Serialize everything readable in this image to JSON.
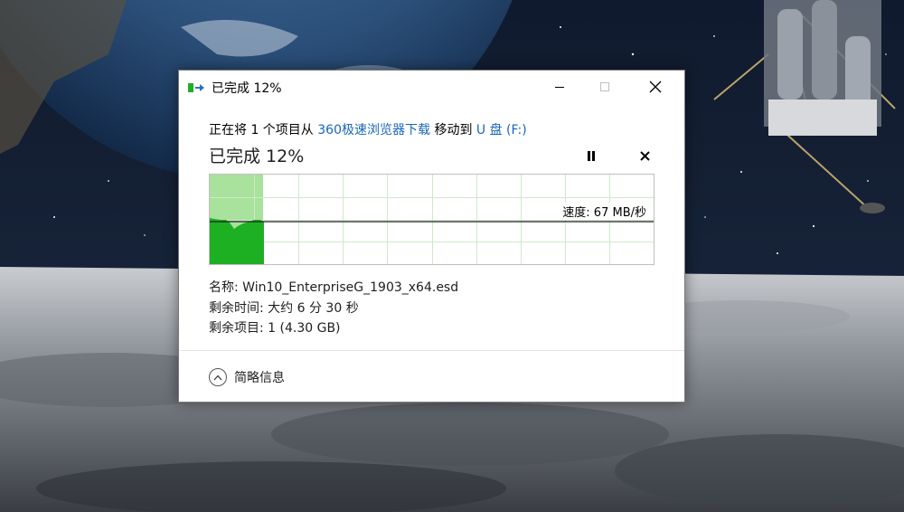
{
  "window": {
    "title": "已完成 12%",
    "minimize_icon": "minimize-icon",
    "maximize_icon": "maximize-icon",
    "close_icon": "close-icon"
  },
  "copy": {
    "prefix": "正在将 1 个项目从 ",
    "source": "360极速浏览器下载",
    "middle": " 移动到 ",
    "destination": "U 盘 (F:)",
    "progress_label": "已完成 12%",
    "progress_fraction": 0.12,
    "speed_label": "速度: 67 MB/秒",
    "name_label": "名称: Win10_EnterpriseG_1903_x64.esd",
    "time_label": "剩余时间: 大约 6 分 30 秒",
    "items_label": "剩余项目: 1 (4.30 GB)"
  },
  "details": {
    "label": "简略信息",
    "icon": "chevron-up-icon"
  },
  "colors": {
    "progress_fill": "#a8e29c",
    "speed_fill": "#1db023",
    "link": "#1a66b8"
  }
}
